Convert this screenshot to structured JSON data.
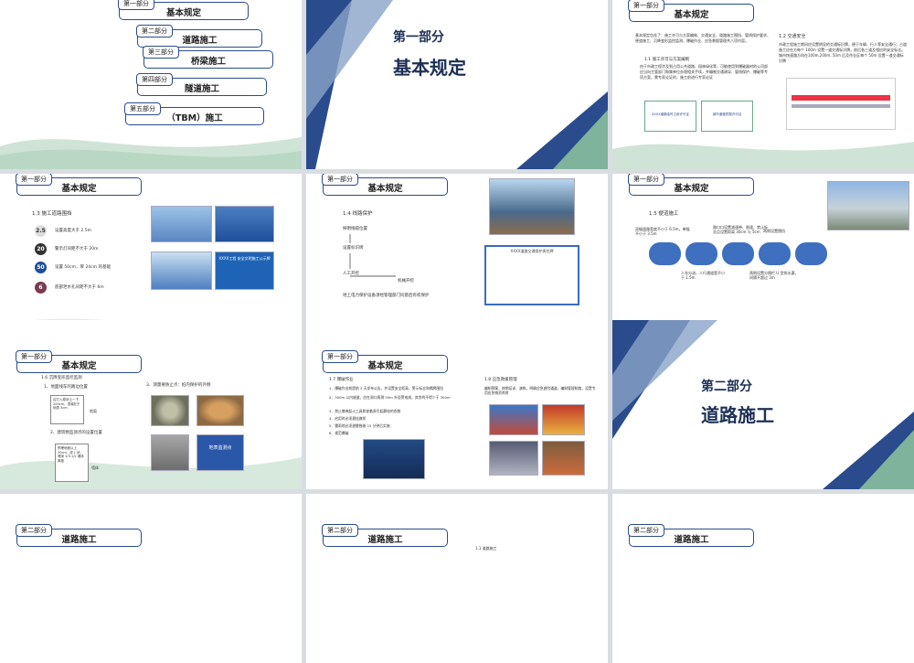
{
  "thumbs": [
    {
      "part": "第一部分",
      "title": "基本规定"
    },
    {
      "part": "第一部分",
      "title": "基本规定"
    },
    {
      "part": "第一部分",
      "title": "基本规定"
    },
    {
      "part": "第一部分",
      "title": "基本规定"
    },
    {
      "part": "第一部分",
      "title": "基本规定"
    },
    {
      "part": "第一部分",
      "title": "基本规定"
    },
    {
      "part": "第一部分",
      "title": "基本规定"
    },
    {
      "part": "第一部分",
      "title": "基本规定"
    },
    {
      "part": "第二部分",
      "title": "道路施工"
    },
    {
      "part": "第二部分",
      "title": "道路施工"
    },
    {
      "part": "第二部分",
      "title": "道路施工"
    }
  ],
  "toc": {
    "items": [
      {
        "part": "第一部分",
        "title": "基本规定"
      },
      {
        "part": "第二部分",
        "title": "道路施工"
      },
      {
        "part": "第三部分",
        "title": "桥梁施工"
      },
      {
        "part": "第四部分",
        "title": "隧道施工"
      },
      {
        "part": "第五部分",
        "title": "（TBM）施工"
      }
    ]
  },
  "section1": {
    "part": "第一部分",
    "title": "基本规定"
  },
  "section2": {
    "part": "第二部分",
    "title": "道路施工"
  },
  "s3": {
    "intro": "基本规定包含了：施工许可与方案编制、交通安全、道路施工围挡、管线保护要求、便道施工、沉降变形监控监测、爆破作业、应急救援管理共八项内容。",
    "h11": "1.1 施工许可与方案编制",
    "p11": "由于市政工程涉及到占用公共道路、园林绿化等，可能使用到爆破器材的公司部应当向主管部门和属单位办理相关手续，并编制交通疏导、管线保护、爆破等专项方案，需专家论证的，施工前进行专家论证",
    "cert1": "XXXX道路临时占用许可证",
    "cert2": "城市道路挖掘许可证",
    "h12": "1.2 交通安全",
    "p12": "市政工程施工期间应设置明显的交通标识牌，便于车辆、行人等安全通行；占道施工应在方每个 100m 设置一道交通标识牌，前后各三道及相应的安全标志。城市快速路方向在100m,200m, 50m 后及作业区每个 50m 设置一道交通标识牌"
  },
  "s4": {
    "h": "1.3 施工道路围挡",
    "items": [
      {
        "badge": "2.5",
        "text": "设置高度大于 2.5m"
      },
      {
        "badge": "20",
        "text": "警示灯间距不大于 20m"
      },
      {
        "badge": "50",
        "text": "设置 50cm，厚 24cm 的基础"
      },
      {
        "badge": "6",
        "text": "底部泄水孔间距不大于 6m"
      }
    ],
    "board": "XXXX工程 安全文明施工公示牌"
  },
  "s5": {
    "h": "1.4 线路保护",
    "flow": [
      "探明线缆位置",
      "设置标识牌",
      "人工开挖",
      "机械开挖"
    ],
    "note": "地上电力保护设备须经管理部门同意后有权保护",
    "table_title": "XXXX道路交通保护责任牌"
  },
  "s6": {
    "h": "1.5 便道施工",
    "notes": [
      "双幅道路宽度不小于 6.5m，单幅不小于 3.5m",
      "路口口设置减速带、限速、禁止标志且设置距离 30cm 与 5cm",
      "两侧设置围挡",
      "人车分流，人行通道宽不小于 1.5m",
      "两侧设置分隔栏 U 型排水渠，间隔不超过 3m"
    ]
  },
  "s7": {
    "h": "1.6 沉降变形监控监测",
    "sub1": "1、地面线车的路边位置",
    "sub3": "3、测量要防止点：桩内保护的外侧",
    "box1": "应打入原状土一下 200cm，顶端在于地表 5cm",
    "box1b": "地面",
    "sub2": "2、建筑物监测点的设置位置",
    "box2": "预埋地面以上 30cm，成 L 状，埋深 1/3-1/2 墙体厚度",
    "box2b": "墙体",
    "sign": "地表监测点"
  },
  "s8": {
    "h17": "1.7 爆破作业",
    "list": [
      "1、爆破作业前提前 3 天发布公告，并设置安全距离、警示标志和揭牌围挡",
      "2、300m 以内隧道，应在洞口两侧 50m 外设警戒线，其余的不得少于 300m",
      "3、禁止携带起火工具和穿着易引起静电的衣物",
      "4、启用时必须悬挂旗帜",
      "5、雷雨地必须避雷措施 15 分钟后实施",
      "6、规范爆破"
    ],
    "h18": "1.8 应急救援管理",
    "p18": "编制预案、按期培训、演练，明确应急避险通道，编制管理制度，设置专用应急物资库房"
  },
  "s12": {
    "h": "1.1 道路施工"
  }
}
